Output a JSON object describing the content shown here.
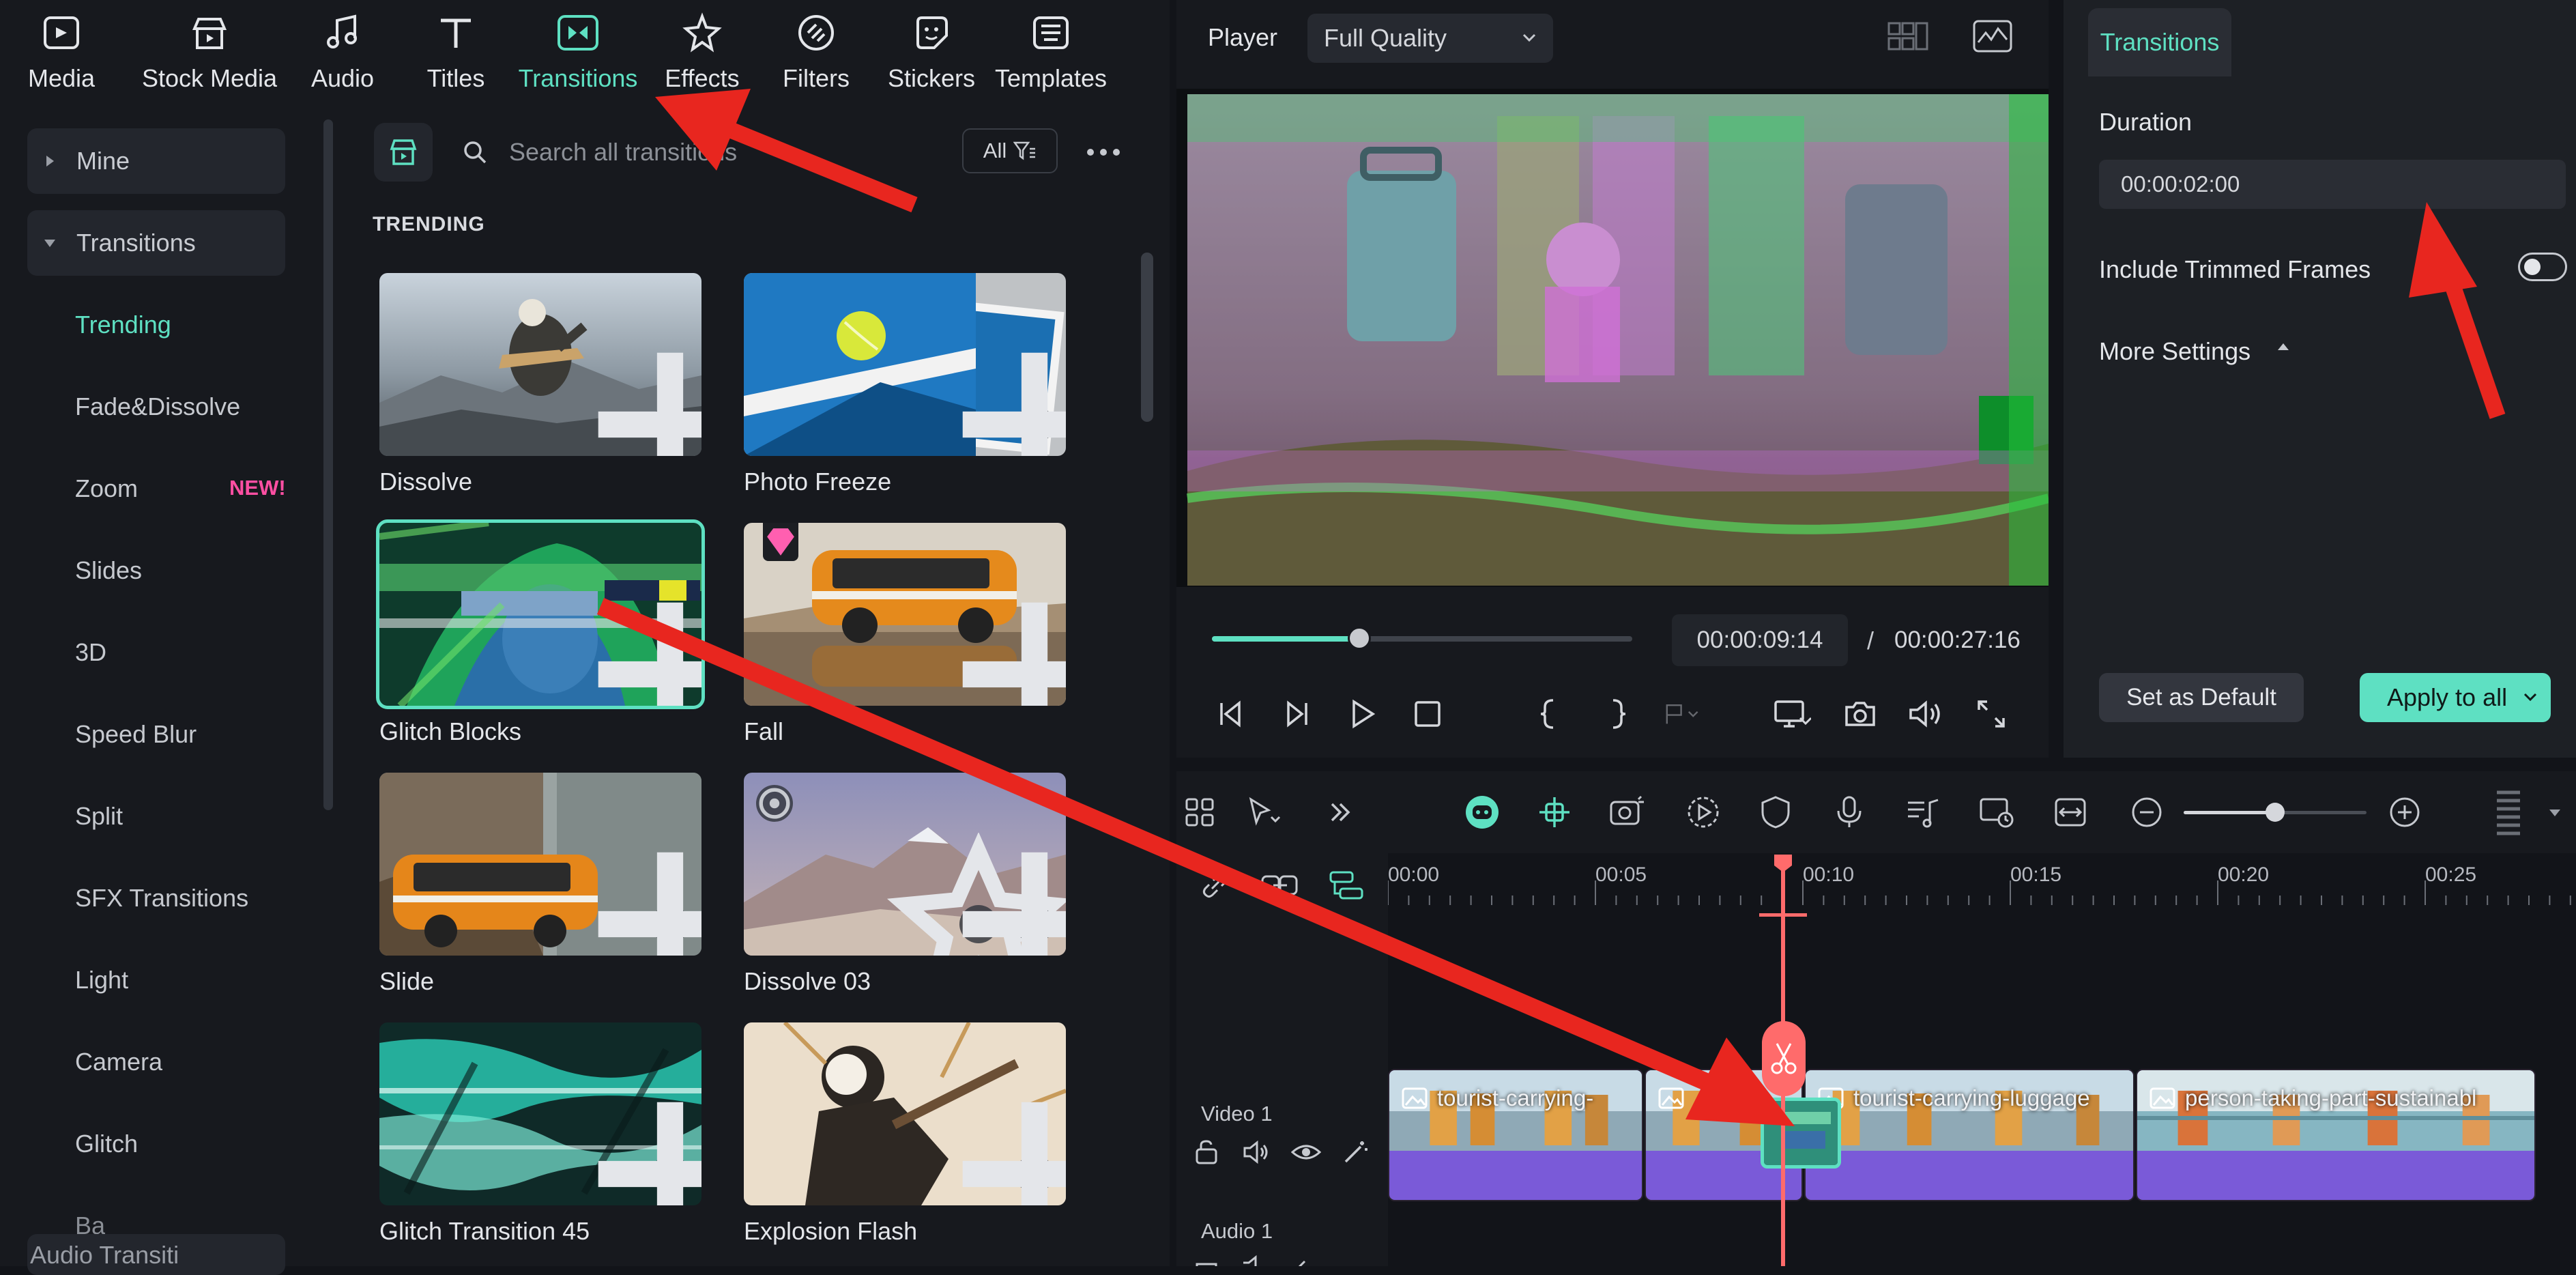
{
  "top_tabs": [
    {
      "label": "Media",
      "icon": "media-icon"
    },
    {
      "label": "Stock Media",
      "icon": "stock-media-icon"
    },
    {
      "label": "Audio",
      "icon": "music-note-icon"
    },
    {
      "label": "Titles",
      "icon": "text-t-icon"
    },
    {
      "label": "Transitions",
      "icon": "transitions-icon",
      "active": true
    },
    {
      "label": "Effects",
      "icon": "effects-sparkle-icon"
    },
    {
      "label": "Filters",
      "icon": "filters-icon"
    },
    {
      "label": "Stickers",
      "icon": "sticker-icon"
    },
    {
      "label": "Templates",
      "icon": "templates-icon"
    }
  ],
  "sidebar": {
    "sections": [
      {
        "label": "Mine",
        "expanded": false
      },
      {
        "label": "Transitions",
        "expanded": true
      },
      {
        "label": "Audio Transiti"
      }
    ],
    "items": [
      {
        "label": "Trending",
        "active": true
      },
      {
        "label": "Fade&Dissolve"
      },
      {
        "label": "Zoom",
        "badge": "NEW!"
      },
      {
        "label": "Slides"
      },
      {
        "label": "3D"
      },
      {
        "label": "Speed Blur"
      },
      {
        "label": "Split"
      },
      {
        "label": "SFX Transitions"
      },
      {
        "label": "Light"
      },
      {
        "label": "Camera"
      },
      {
        "label": "Glitch"
      },
      {
        "label": "Ba"
      }
    ]
  },
  "library": {
    "search_placeholder": "Search all transitions",
    "filter_label": "All",
    "section_title": "TRENDING",
    "cards": [
      {
        "label": "Dissolve"
      },
      {
        "label": "Photo Freeze"
      },
      {
        "label": "Glitch Blocks",
        "selected": true
      },
      {
        "label": "Fall",
        "premium": true
      },
      {
        "label": "Slide"
      },
      {
        "label": "Dissolve 03"
      },
      {
        "label": "Glitch Transition 45"
      },
      {
        "label": "Explosion Flash"
      }
    ]
  },
  "player": {
    "label": "Player",
    "quality": "Full Quality",
    "current_time": "00:00:09:14",
    "separator": "/",
    "total_time": "00:00:27:16",
    "progress": 0.35
  },
  "properties": {
    "tab": "Transitions",
    "duration_label": "Duration",
    "duration_value": "00:00:02:00",
    "include_trimmed_label": "Include Trimmed Frames",
    "include_trimmed_on": false,
    "more_settings_label": "More Settings",
    "set_default_label": "Set as Default",
    "apply_all_label": "Apply to all"
  },
  "timeline": {
    "ruler": [
      "00:00",
      "00:05",
      "00:10",
      "00:15",
      "00:20",
      "00:25"
    ],
    "playhead_time": "00:10",
    "tracks": [
      {
        "label": "Video 1"
      },
      {
        "label": "Audio 1"
      }
    ],
    "clips": [
      {
        "name": "tourist-carrying-"
      },
      {
        "name": "t"
      },
      {
        "name": "tourist-carrying-luggage"
      },
      {
        "name": "person-taking-part-sustainabl"
      }
    ],
    "zoom_level": 0.5
  },
  "colors": {
    "accent": "#5ee0c2",
    "new_badge": "#ff4fa3",
    "clip": "#7a5ad8",
    "playhead": "#ff6b6b",
    "annotation_arrow": "#e8261f"
  }
}
